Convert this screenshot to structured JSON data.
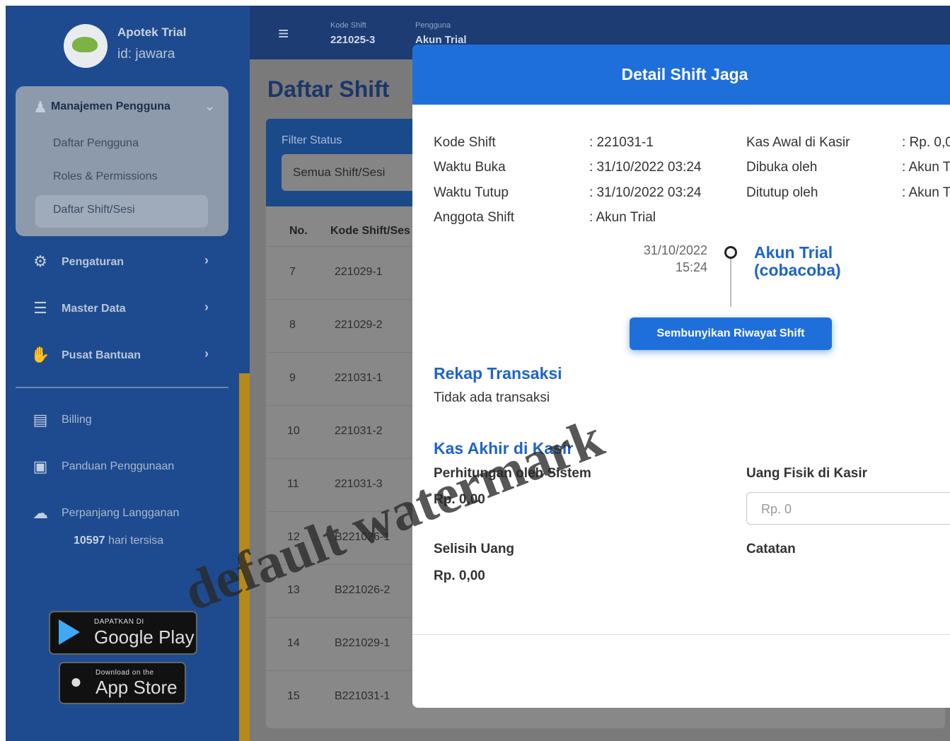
{
  "brand": {
    "name": "Apotek Trial",
    "id": "id: jawara"
  },
  "sidebar": {
    "user_mgmt": {
      "title": "Manajemen Pengguna",
      "items": [
        "Daftar Pengguna",
        "Roles & Permissions",
        "Daftar Shift/Sesi"
      ]
    },
    "nav": [
      "Pengaturan",
      "Master Data",
      "Pusat Bantuan"
    ],
    "extra": [
      "Billing",
      "Panduan Penggunaan",
      "Perpanjang Langganan"
    ],
    "days_count": "10597",
    "days_suffix": "hari tersisa",
    "google_play": {
      "small": "DAPATKAN DI",
      "big": "Google Play"
    },
    "app_store": {
      "small": "Download on the",
      "big": "App Store"
    },
    "icons": [
      "user-cog-icon",
      "gear-icon",
      "database-icon",
      "handshake-icon",
      "receipt-icon",
      "book-icon",
      "cloud-upload-icon"
    ]
  },
  "topbar": {
    "shift_label": "Kode Shift",
    "shift_value": "221025-3",
    "user_label": "Pengguna",
    "user_value": "Akun Trial"
  },
  "page": {
    "title": "Daftar Shift",
    "filter_label": "Filter Status",
    "filter_value": "Semua Shift/Sesi",
    "columns": [
      "No.",
      "Kode Shift/Ses"
    ],
    "rows": [
      {
        "no": "7",
        "code": "221029-1"
      },
      {
        "no": "8",
        "code": "221029-2"
      },
      {
        "no": "9",
        "code": "221031-1"
      },
      {
        "no": "10",
        "code": "221031-2"
      },
      {
        "no": "11",
        "code": "221031-3"
      },
      {
        "no": "12",
        "code": "B221026-1"
      },
      {
        "no": "13",
        "code": "B221026-2"
      },
      {
        "no": "14",
        "code": "B221029-1"
      },
      {
        "no": "15",
        "code": "B221031-1"
      }
    ]
  },
  "modal": {
    "title": "Detail Shift Jaga",
    "left_fields": [
      {
        "label": "Kode Shift",
        "value": ": 221031-1"
      },
      {
        "label": "Waktu Buka",
        "value": ": 31/10/2022 03:24"
      },
      {
        "label": "Waktu Tutup",
        "value": ": 31/10/2022 03:24"
      },
      {
        "label": "Anggota Shift",
        "value": ": Akun Trial"
      }
    ],
    "right_fields": [
      {
        "label": "Kas Awal di Kasir",
        "value": ": Rp. 0,0"
      },
      {
        "label": "Dibuka oleh",
        "value": ": Akun T"
      },
      {
        "label": "Ditutup oleh",
        "value": ": Akun T"
      }
    ],
    "timeline": {
      "date": "31/10/2022",
      "time": "15:24",
      "name": "Akun Trial (cobacoba)"
    },
    "history_button": "Sembunyikan Riwayat Shift",
    "rekap_title": "Rekap Transaksi",
    "rekap_empty": "Tidak ada transaksi",
    "kas_title": "Kas Akhir di Kasir",
    "system_label": "Perhitungan oleh Sistem",
    "system_value": "Rp. 0,00",
    "physical_label": "Uang Fisik di Kasir",
    "physical_placeholder": "Rp. 0",
    "diff_label": "Selisih Uang",
    "diff_value": "Rp. 0,00",
    "notes_label": "Catatan"
  },
  "watermark": "default watermark",
  "colors": {
    "primary": "#1f6fdb",
    "sidebar": "#1e4b8f",
    "heading": "#1f64c8"
  }
}
